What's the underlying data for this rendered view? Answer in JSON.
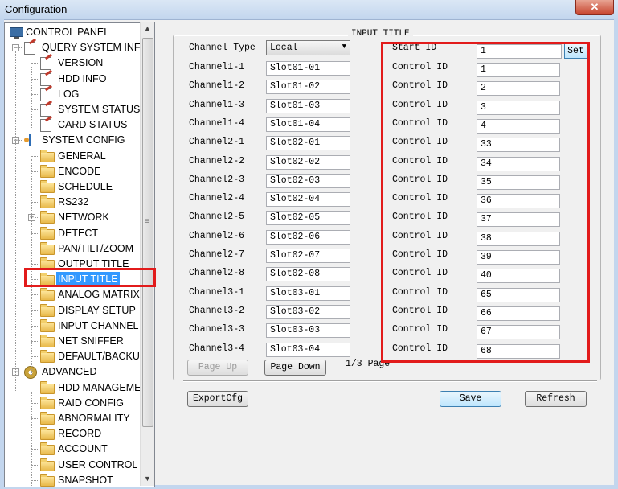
{
  "window": {
    "title": "Configuration",
    "close_label": "✕"
  },
  "tree": {
    "items": [
      {
        "label": "CONTROL PANEL",
        "level": 0,
        "icon": "monitor-icon",
        "expander": ""
      },
      {
        "label": "QUERY SYSTEM INFO",
        "level": 1,
        "icon": "document-icon",
        "expander": "−"
      },
      {
        "label": "VERSION",
        "level": 2,
        "icon": "document-icon",
        "expander": ""
      },
      {
        "label": "HDD INFO",
        "level": 2,
        "icon": "document-icon",
        "expander": ""
      },
      {
        "label": "LOG",
        "level": 2,
        "icon": "document-icon",
        "expander": ""
      },
      {
        "label": "SYSTEM STATUS",
        "level": 2,
        "icon": "document-icon",
        "expander": ""
      },
      {
        "label": "CARD STATUS",
        "level": 2,
        "icon": "document-icon",
        "expander": ""
      },
      {
        "label": "SYSTEM CONFIG",
        "level": 1,
        "icon": "tools-icon",
        "expander": "−"
      },
      {
        "label": "GENERAL",
        "level": 2,
        "icon": "folder-icon",
        "expander": ""
      },
      {
        "label": "ENCODE",
        "level": 2,
        "icon": "folder-icon",
        "expander": ""
      },
      {
        "label": "SCHEDULE",
        "level": 2,
        "icon": "folder-icon",
        "expander": ""
      },
      {
        "label": "RS232",
        "level": 2,
        "icon": "folder-icon",
        "expander": ""
      },
      {
        "label": "NETWORK",
        "level": 2,
        "icon": "folder-icon",
        "expander": "+"
      },
      {
        "label": "DETECT",
        "level": 2,
        "icon": "folder-icon",
        "expander": ""
      },
      {
        "label": "PAN/TILT/ZOOM",
        "level": 2,
        "icon": "folder-icon",
        "expander": ""
      },
      {
        "label": "OUTPUT TITLE",
        "level": 2,
        "icon": "folder-icon",
        "expander": ""
      },
      {
        "label": "INPUT TITLE",
        "level": 2,
        "icon": "folder-icon",
        "expander": "",
        "selected": true
      },
      {
        "label": "ANALOG MATRIX",
        "level": 2,
        "icon": "folder-icon",
        "expander": ""
      },
      {
        "label": "DISPLAY SETUP",
        "level": 2,
        "icon": "folder-icon",
        "expander": ""
      },
      {
        "label": "INPUT CHANNEL",
        "level": 2,
        "icon": "folder-icon",
        "expander": ""
      },
      {
        "label": "NET SNIFFER",
        "level": 2,
        "icon": "folder-icon",
        "expander": ""
      },
      {
        "label": "DEFAULT/BACKUP",
        "level": 2,
        "icon": "folder-icon",
        "expander": ""
      },
      {
        "label": "ADVANCED",
        "level": 1,
        "icon": "gear-icon",
        "expander": "−"
      },
      {
        "label": "HDD MANAGEMENT",
        "level": 2,
        "icon": "folder-icon",
        "expander": ""
      },
      {
        "label": "RAID CONFIG",
        "level": 2,
        "icon": "folder-icon",
        "expander": ""
      },
      {
        "label": "ABNORMALITY",
        "level": 2,
        "icon": "folder-icon",
        "expander": ""
      },
      {
        "label": "RECORD",
        "level": 2,
        "icon": "folder-icon",
        "expander": ""
      },
      {
        "label": "ACCOUNT",
        "level": 2,
        "icon": "folder-icon",
        "expander": ""
      },
      {
        "label": "USER CONTROL",
        "level": 2,
        "icon": "folder-icon",
        "expander": ""
      },
      {
        "label": "SNAPSHOT",
        "level": 2,
        "icon": "folder-icon",
        "expander": ""
      }
    ],
    "scroll_up": "▲",
    "scroll_down": "▼",
    "scroll_grip": "≡"
  },
  "panel": {
    "legend": "INPUT TITLE",
    "channel_type_label": "Channel Type",
    "channel_type_value": "Local",
    "channel_type_arrow": "▼",
    "start_id_label": "Start ID",
    "start_id_value": "1",
    "set_label": "Set",
    "control_id_label": "Control ID",
    "rows": [
      {
        "channel": "Channel1-1",
        "slot": "Slot01-01",
        "control_id": "1"
      },
      {
        "channel": "Channel1-2",
        "slot": "Slot01-02",
        "control_id": "2"
      },
      {
        "channel": "Channel1-3",
        "slot": "Slot01-03",
        "control_id": "3"
      },
      {
        "channel": "Channel1-4",
        "slot": "Slot01-04",
        "control_id": "4"
      },
      {
        "channel": "Channel2-1",
        "slot": "Slot02-01",
        "control_id": "33"
      },
      {
        "channel": "Channel2-2",
        "slot": "Slot02-02",
        "control_id": "34"
      },
      {
        "channel": "Channel2-3",
        "slot": "Slot02-03",
        "control_id": "35"
      },
      {
        "channel": "Channel2-4",
        "slot": "Slot02-04",
        "control_id": "36"
      },
      {
        "channel": "Channel2-5",
        "slot": "Slot02-05",
        "control_id": "37"
      },
      {
        "channel": "Channel2-6",
        "slot": "Slot02-06",
        "control_id": "38"
      },
      {
        "channel": "Channel2-7",
        "slot": "Slot02-07",
        "control_id": "39"
      },
      {
        "channel": "Channel2-8",
        "slot": "Slot02-08",
        "control_id": "40"
      },
      {
        "channel": "Channel3-1",
        "slot": "Slot03-01",
        "control_id": "65"
      },
      {
        "channel": "Channel3-2",
        "slot": "Slot03-02",
        "control_id": "66"
      },
      {
        "channel": "Channel3-3",
        "slot": "Slot03-03",
        "control_id": "67"
      },
      {
        "channel": "Channel3-4",
        "slot": "Slot03-04",
        "control_id": "68"
      }
    ],
    "page_up_label": "Page Up",
    "page_down_label": "Page Down",
    "page_indicator": "1/3 Page"
  },
  "footer": {
    "export_label": "ExportCfg",
    "save_label": "Save",
    "refresh_label": "Refresh"
  },
  "colors": {
    "highlight": "#e21b1b",
    "accent": "#3c7fb1"
  }
}
